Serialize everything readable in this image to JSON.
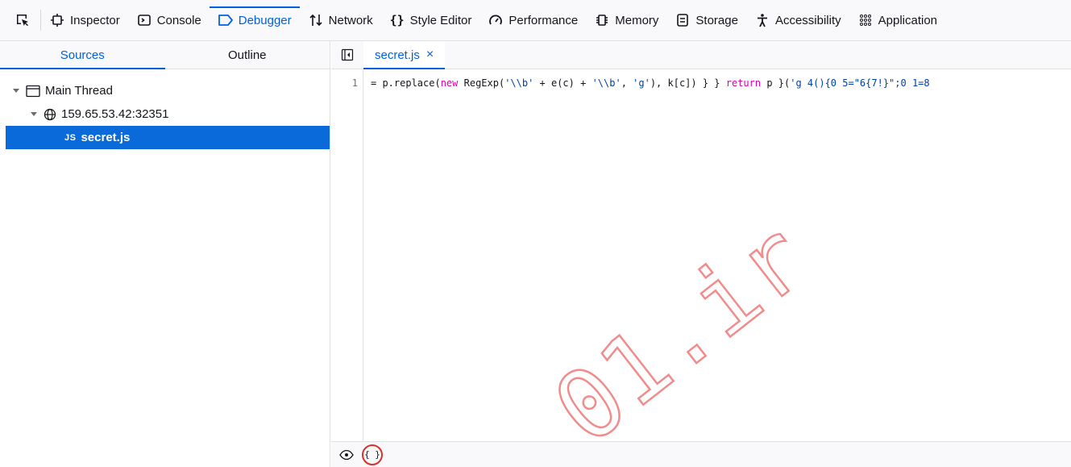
{
  "toolbar": {
    "tabs": [
      {
        "label": "Inspector",
        "icon": "inspector-icon"
      },
      {
        "label": "Console",
        "icon": "console-icon"
      },
      {
        "label": "Debugger",
        "icon": "debugger-icon",
        "active": true
      },
      {
        "label": "Network",
        "icon": "network-icon"
      },
      {
        "label": "Style Editor",
        "icon": "style-editor-icon"
      },
      {
        "label": "Performance",
        "icon": "performance-icon"
      },
      {
        "label": "Memory",
        "icon": "memory-icon"
      },
      {
        "label": "Storage",
        "icon": "storage-icon"
      },
      {
        "label": "Accessibility",
        "icon": "accessibility-icon"
      },
      {
        "label": "Application",
        "icon": "application-icon"
      }
    ]
  },
  "left_pane": {
    "tabs": [
      {
        "label": "Sources",
        "active": true
      },
      {
        "label": "Outline"
      }
    ],
    "tree": {
      "thread": "Main Thread",
      "host": "159.65.53.42:32351",
      "file_badge": "JS",
      "file": "secret.js"
    }
  },
  "editor": {
    "tab_label": "secret.js",
    "close_glyph": "×",
    "line_number": "1",
    "code": {
      "p1": "= p.replace(",
      "kw_new": "new",
      "p2": " RegExp(",
      "s1": "'\\\\b'",
      "p3": " + e(c) + ",
      "s2": "'\\\\b'",
      "p4": ", ",
      "s3": "'g'",
      "p5": "), k[c]) } } ",
      "kw_return": "return",
      "p6": " p }(",
      "s4": "'g 4(){0 5=\"6{7!}\";0 1=8"
    },
    "pretty_print_label": "{ }"
  },
  "watermark": {
    "text": "01.ir",
    "color": "#f08c8c"
  },
  "colors": {
    "accent": "#0061e0",
    "selection": "#0a6ad9",
    "highlight_ring": "#d9312b"
  }
}
